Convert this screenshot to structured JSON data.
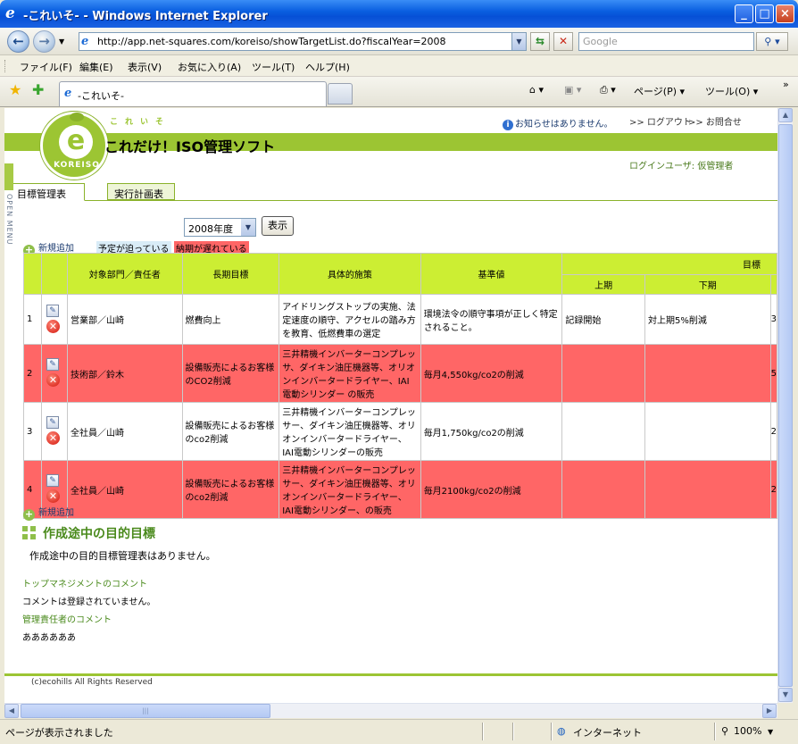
{
  "window": {
    "title": "-これいそ- - Windows Internet Explorer"
  },
  "address": {
    "url": "http://app.net-squares.com/koreiso/showTargetList.do?fiscalYear=2008",
    "search_placeholder": "Google"
  },
  "menu": [
    "ファイル(F)",
    "編集(E)",
    "表示(V)",
    "お気に入り(A)",
    "ツール(T)",
    "ヘルプ(H)"
  ],
  "browser_tab": {
    "label": "-これいそ-"
  },
  "toolbar": {
    "page": "ページ(P) ▾",
    "tools": "ツール(O) ▾"
  },
  "app": {
    "logo_text": "KOREISO",
    "kana": "これいそ",
    "title": "これだけ！ISO管理ソフト",
    "notice": "お知らせはありません。",
    "logout": ">> ログアウト",
    "contact": ">> お問合せ",
    "login_user": "ログインユーザ: 仮管理者",
    "open_menu": "OPEN MENU",
    "tabs": [
      "目標管理表",
      "実行計画表"
    ],
    "year_selected": "2008年度",
    "show_button": "表示",
    "add_new": "新規追加",
    "legend_due": "予定が迫っている",
    "legend_late": "納期が遅れている",
    "table": {
      "headers": {
        "dept": "対象部門／責任者",
        "long": "長期目標",
        "measure": "具体的施策",
        "base": "基準値",
        "goal": "目標",
        "h1": "上期",
        "h2": "下期"
      },
      "rows": [
        {
          "no": "1",
          "dept": "営業部／山崎",
          "long": "燃費向上",
          "measure": "アイドリングストップの実施、法定速度の順守、アクセルの踏み方を教育、低燃費車の選定",
          "base": "環境法令の順守事項が正しく特定されること。",
          "h1": "記録開始",
          "h2": "対上期5%削減",
          "tail": "3"
        },
        {
          "no": "2",
          "dept": "技術部／鈴木",
          "long": "設備販売によるお客様のCO2削減",
          "measure": "三井精機インバーターコンプレッサ、ダイキン油圧機器等、オリオンインバータードライヤー、IAI電動シリンダー の販売",
          "base": "毎月4,550kg/co2の削減",
          "h1": "",
          "h2": "",
          "tail": "5"
        },
        {
          "no": "3",
          "dept": "全社員／山崎",
          "long": "設備販売によるお客様のco2削減",
          "measure": "三井精機インバーターコンプレッサー、ダイキン油圧機器等、オリオンインバータードライヤー、IAI電動シリンダーの販売",
          "base": "毎月1,750kg/co2の削減",
          "h1": "",
          "h2": "",
          "tail": "2"
        },
        {
          "no": "4",
          "dept": "全社員／山崎",
          "long": "設備販売によるお客様のco2削減",
          "measure": "三井精機インバーターコンプレッサー、ダイキン油圧機器等、オリオンインバータードライヤー、IAI電動シリンダー、の販売",
          "base": "毎月2100kg/co2の削減",
          "h1": "",
          "h2": "",
          "tail": "2"
        }
      ]
    },
    "draft_title": "作成途中の目的目標",
    "draft_msg": "作成途中の目的目標管理表はありません。",
    "top_mgmt_label": "トップマネジメントのコメント",
    "top_mgmt_text": "コメントは登録されていません。",
    "mgr_label": "管理責任者のコメント",
    "mgr_text": "ああああああ",
    "footer": "(c)ecohills All Rights Reserved"
  },
  "status": {
    "text": "ページが表示されました",
    "zone": "インターネット",
    "zoom": "100%"
  }
}
